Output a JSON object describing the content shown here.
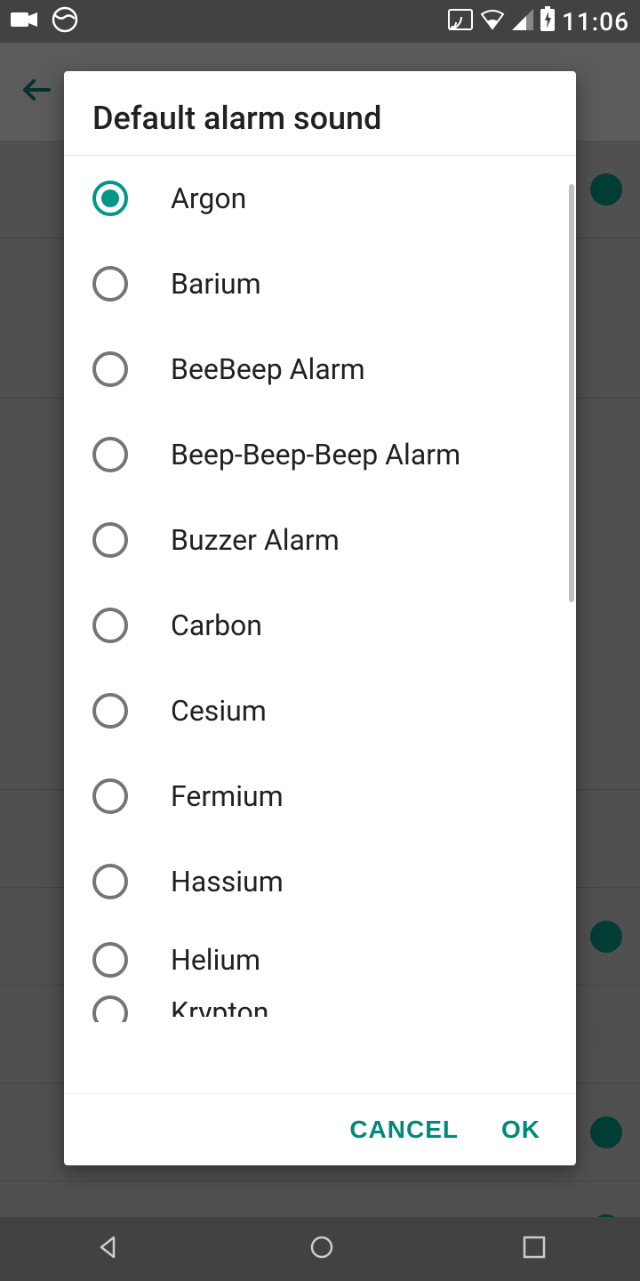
{
  "status": {
    "time": "11:06"
  },
  "dialog": {
    "title": "Default alarm sound",
    "options": [
      {
        "label": "Argon",
        "selected": true
      },
      {
        "label": "Barium",
        "selected": false
      },
      {
        "label": "BeeBeep Alarm",
        "selected": false
      },
      {
        "label": "Beep-Beep-Beep Alarm",
        "selected": false
      },
      {
        "label": "Buzzer Alarm",
        "selected": false
      },
      {
        "label": "Carbon",
        "selected": false
      },
      {
        "label": "Cesium",
        "selected": false
      },
      {
        "label": "Fermium",
        "selected": false
      },
      {
        "label": "Hassium",
        "selected": false
      },
      {
        "label": "Helium",
        "selected": false
      },
      {
        "label": "Krypton",
        "selected": false
      }
    ],
    "cancel_label": "CANCEL",
    "ok_label": "OK"
  }
}
